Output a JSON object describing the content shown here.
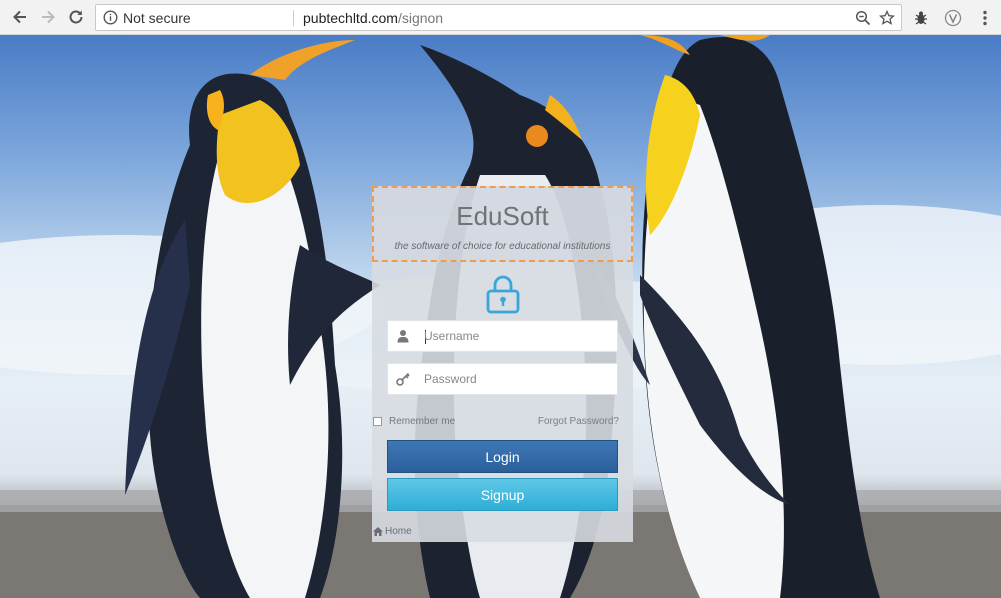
{
  "browser": {
    "security_label": "Not secure",
    "url_host": "pubtechltd.com",
    "url_path": "/signon",
    "icons": [
      "back-icon",
      "forward-icon",
      "reload-icon",
      "info-icon",
      "zoom-icon",
      "star-icon",
      "extension-icon",
      "vivaldi-extension-icon",
      "menu-icon"
    ]
  },
  "login": {
    "brand_title": "EduSoft",
    "brand_tagline": "the software of choice for educational institutions",
    "username_placeholder": "Username",
    "password_placeholder": "Password",
    "remember_label": "Remember me",
    "forgot_label": "Forgot Password?",
    "login_label": "Login",
    "signup_label": "Signup",
    "home_label": "Home"
  },
  "colors": {
    "accent_dashed": "#f29b4a",
    "login_button": "#2f66a6",
    "signup_button": "#3bb6dd",
    "lock_icon": "#3aa6d8"
  }
}
